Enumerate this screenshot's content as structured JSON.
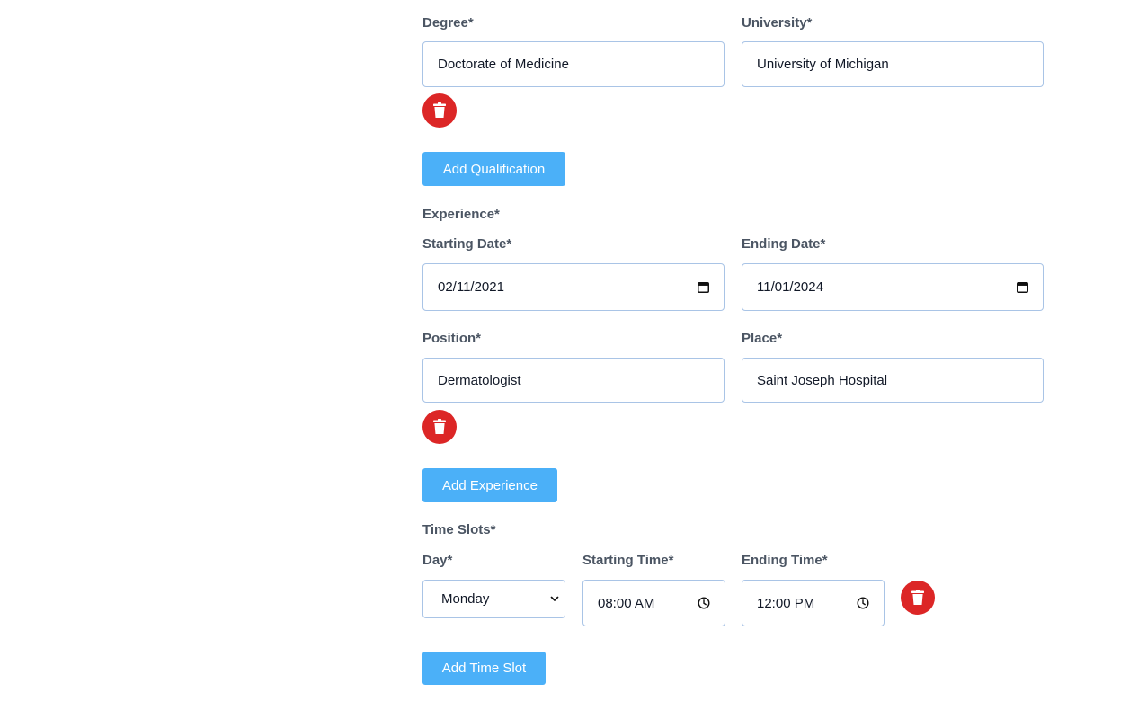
{
  "qualification": {
    "degree_label": "Degree*",
    "degree_value": "Doctorate of Medicine",
    "university_label": "University*",
    "university_value": "University of Michigan",
    "add_button": "Add Qualification"
  },
  "experience": {
    "section_label": "Experience*",
    "start_label": "Starting Date*",
    "start_value": "02/11/2021",
    "end_label": "Ending Date*",
    "end_value": "11/01/2024",
    "position_label": "Position*",
    "position_value": "Dermatologist",
    "place_label": "Place*",
    "place_value": "Saint Joseph Hospital",
    "add_button": "Add Experience"
  },
  "time_slots": {
    "section_label": "Time Slots*",
    "day_label": "Day*",
    "day_value": "Monday",
    "start_label": "Starting Time*",
    "start_value": "08:00 AM",
    "end_label": "Ending Time*",
    "end_value": "12:00 PM",
    "add_button": "Add Time Slot"
  },
  "colors": {
    "delete": "#dc2626",
    "primary": "#4bb0f8",
    "field_border": "#a9c4e6"
  },
  "icons": {
    "delete": "trash-icon",
    "date": "calendar-icon",
    "time": "clock-icon",
    "select": "chevron-down-icon"
  }
}
